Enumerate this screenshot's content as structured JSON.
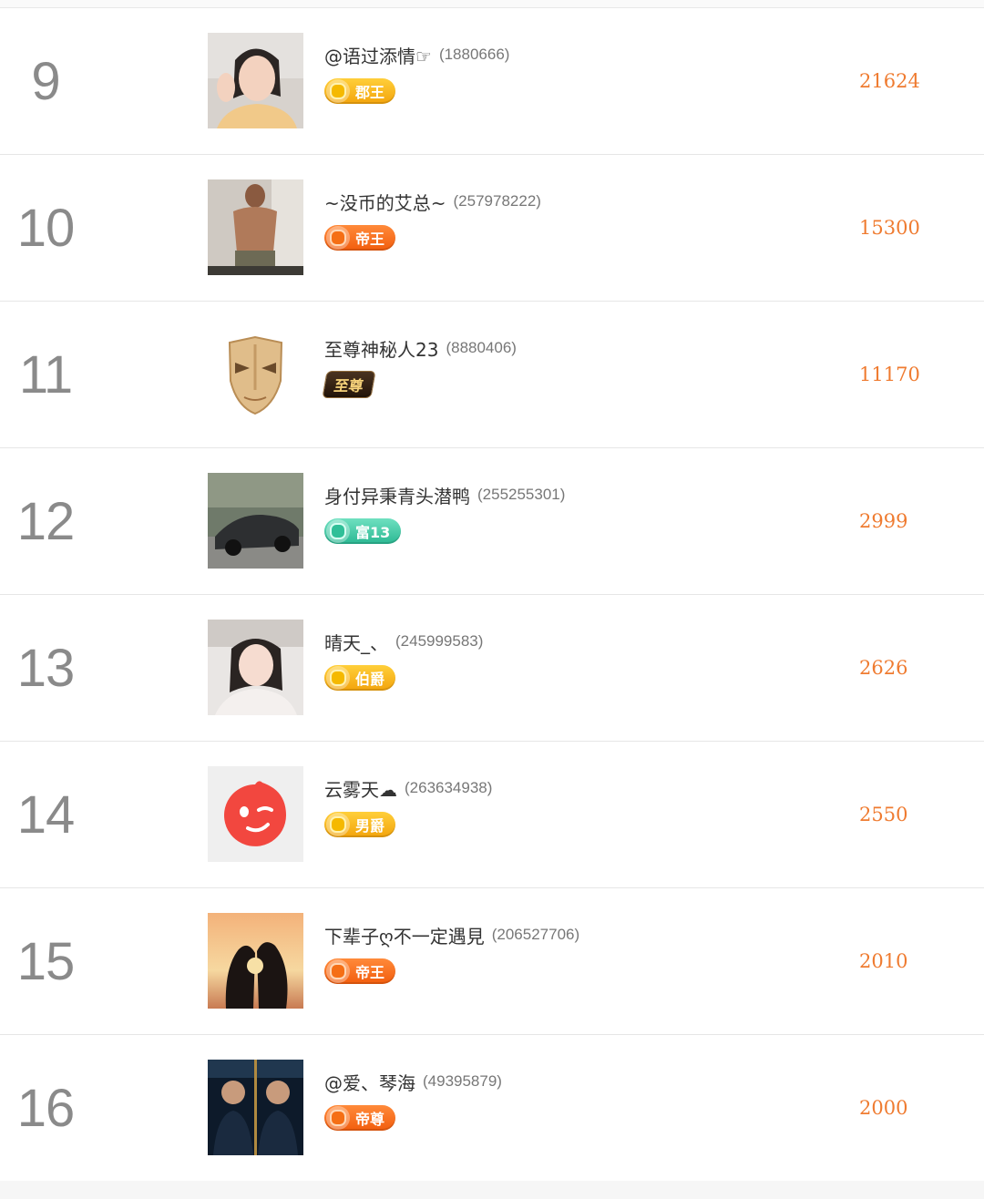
{
  "ranking": [
    {
      "rank": "9",
      "nickname": "@语过添情☞",
      "uid": "(1880666)",
      "badge": "郡王",
      "badge_style": "gold",
      "score": "21624",
      "avatar_icon": "portrait-woman-icon"
    },
    {
      "rank": "10",
      "nickname": "~没币的艾总~",
      "uid": "(257978222)",
      "badge": "帝王",
      "badge_style": "orange",
      "score": "15300",
      "avatar_icon": "portrait-man-shirtless-icon"
    },
    {
      "rank": "11",
      "nickname": "至尊神秘人23",
      "uid": "(8880406)",
      "badge": "至尊",
      "badge_style": "dark",
      "score": "11170",
      "avatar_icon": "gold-mask-icon"
    },
    {
      "rank": "12",
      "nickname": "身付异秉青头潜鸭",
      "uid": "(255255301)",
      "badge": "富13",
      "badge_style": "green",
      "score": "2999",
      "avatar_icon": "sports-car-icon"
    },
    {
      "rank": "13",
      "nickname": "晴天_、",
      "uid": "(245999583)",
      "badge": "伯爵",
      "badge_style": "gold",
      "score": "2626",
      "avatar_icon": "portrait-woman-icon"
    },
    {
      "rank": "14",
      "nickname": "云雾天☁",
      "uid": "(263634938)",
      "badge": "男爵",
      "badge_style": "gold",
      "score": "2550",
      "avatar_icon": "winking-face-icon"
    },
    {
      "rank": "15",
      "nickname": "下辈子ღ不一定遇見",
      "uid": "(206527706)",
      "badge": "帝王",
      "badge_style": "orange",
      "score": "2010",
      "avatar_icon": "couple-silhouette-icon"
    },
    {
      "rank": "16",
      "nickname": "@爱、琴海",
      "uid": "(49395879)",
      "badge": "帝尊",
      "badge_style": "orange",
      "score": "2000",
      "avatar_icon": "mirrored-man-icon"
    }
  ],
  "colors": {
    "rank_text": "#8a8a8a",
    "score_text": "#ef7b30",
    "badge_gold": "#f3a40c",
    "badge_orange": "#f25d0d",
    "badge_green": "#2bb893",
    "badge_dark": "#231409"
  }
}
